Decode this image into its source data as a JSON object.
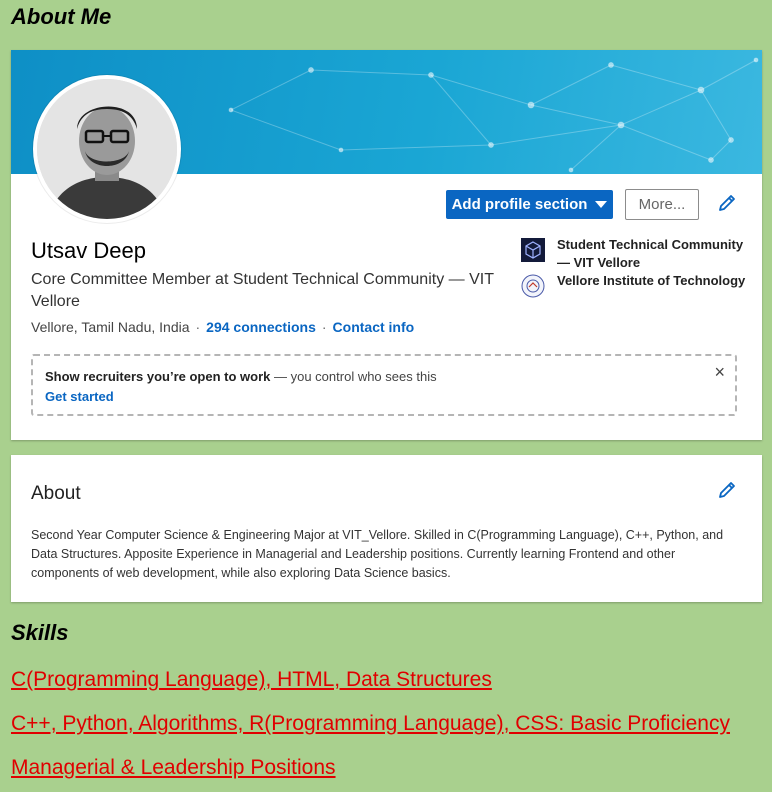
{
  "heading": "About Me",
  "profile": {
    "name": "Utsav Deep",
    "headline": "Core Committee Member at Student Technical Community — VIT Vellore",
    "location": "Vellore, Tamil Nadu, India",
    "connections": "294 connections",
    "contact": "Contact info",
    "add_section_label": "Add profile section",
    "more_label": "More...",
    "orgs": [
      {
        "name": "Student Technical Community — VIT Vellore",
        "icon": "cube-logo-icon"
      },
      {
        "name": "Vellore Institute of Technology",
        "icon": "university-seal-icon"
      }
    ],
    "open_to_work": {
      "bold": "Show recruiters you’re open to work",
      "rest": " — you control who sees this",
      "cta": "Get started",
      "close": "×"
    }
  },
  "about": {
    "title": "About",
    "text": "Second Year Computer Science & Engineering Major at VIT_Vellore. Skilled in C(Programming Language), C++, Python, and Data Structures. Apposite Experience in Managerial and Leadership positions. Currently learning Frontend and other components of web development, while also exploring Data Science basics."
  },
  "skills": {
    "heading": "Skills",
    "items": [
      "C(Programming Language), HTML, Data Structures",
      "C++, Python, Algorithms, R(Programming Language), CSS: Basic Proficiency",
      "Managerial & Leadership Positions"
    ]
  },
  "colors": {
    "page_bg": "#a9d08e",
    "brand_blue": "#0a66c2",
    "skill_red": "#e00000"
  }
}
